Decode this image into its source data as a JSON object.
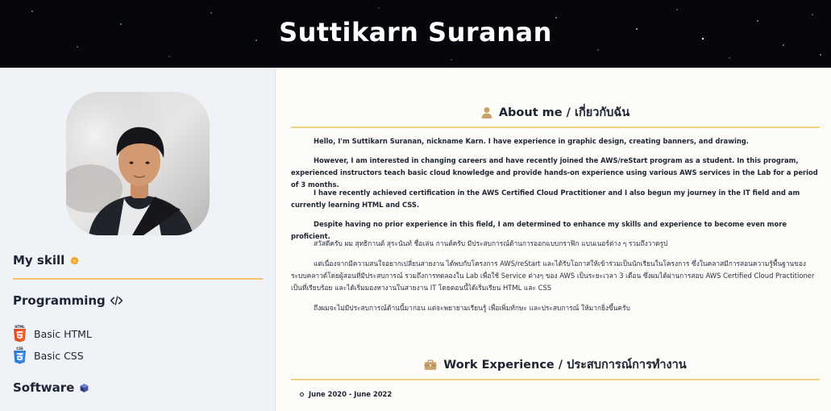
{
  "header": {
    "name": "Suttikarn Suranan"
  },
  "sidebar": {
    "my_skill": "My skill",
    "programming": "Programming",
    "skills": [
      {
        "label": "Basic HTML",
        "icon": "html5-icon",
        "badge": "HTML"
      },
      {
        "label": "Basic CSS",
        "icon": "css3-icon",
        "badge": "CSS"
      }
    ],
    "software": "Software"
  },
  "about": {
    "title": "About me / เกี่ยวกับฉัน",
    "paragraphs": [
      "Hello, I'm Suttikarn Suranan, nickname Karn. I have experience in graphic design, creating banners, and drawing.",
      "However, I am interested in changing careers and have recently joined the AWS/reStart program as a student. In this program, experienced instructors teach basic cloud knowledge and provide hands-on experience using various AWS services in the Lab for a period of 3 months.",
      "I have recently achieved certification in the AWS Certified Cloud Practitioner and I also begun my journey in the IT field and am currently learning HTML and CSS.",
      "Despite having no prior experience in this field, I am determined to enhance my skills and experience to become even more proficient.",
      "สวัสดีครับ ผม สุทธิกานต์ สุระนันท์ ชื่อเล่น กานต์ครับ มีประสบการณ์ด้านการออกแบบกราฟิก แบนเนอร์ต่าง ๆ รวมถึงวาดรูป",
      "แต่เนื่องจากมีความสนใจอยากเปลี่ยนสายงาน ได้พบกับโครงการ AWS/reStart และได้รับโอกาสให้เข้าร่วมเป็นนักเรียนในโครงการ ซึ่งในคลาสมีการสอนความรู้พื้นฐานของระบบคลาวด์โดยผู้สอนที่มีประสบการณ์ รวมถึงการทดลองใน Lab เพื่อใช้ Service ต่างๆ ของ AWS เป็นระยะเวลา 3 เดือน ซึ่งผมได้ผ่านการสอบ AWS Certified Cloud Practitioner เป็นที่เรียบร้อย และได้เริ่มมองหางานในสายงาน IT โดยตอนนี้ได้เริ่มเรียน HTML และ CSS",
      "ถึงผมจะไม่มีประสบการณ์ด้านนี้มาก่อน แต่จะพยายามเรียนรู้ เพื่อเพิ่มทักษะ และประสบการณ์ ให้มากยิ่งขึ้นครับ"
    ]
  },
  "work": {
    "title": "Work Experience / ประสบการณ์การทำงาน",
    "first_item": "June 2020 - June 2022"
  },
  "colors": {
    "accent_gold": "#f1cf7f",
    "header_bg": "#05070d",
    "sidebar_bg": "#eff3f8",
    "html_orange": "#e44d26",
    "css_blue": "#2f7bd5"
  }
}
